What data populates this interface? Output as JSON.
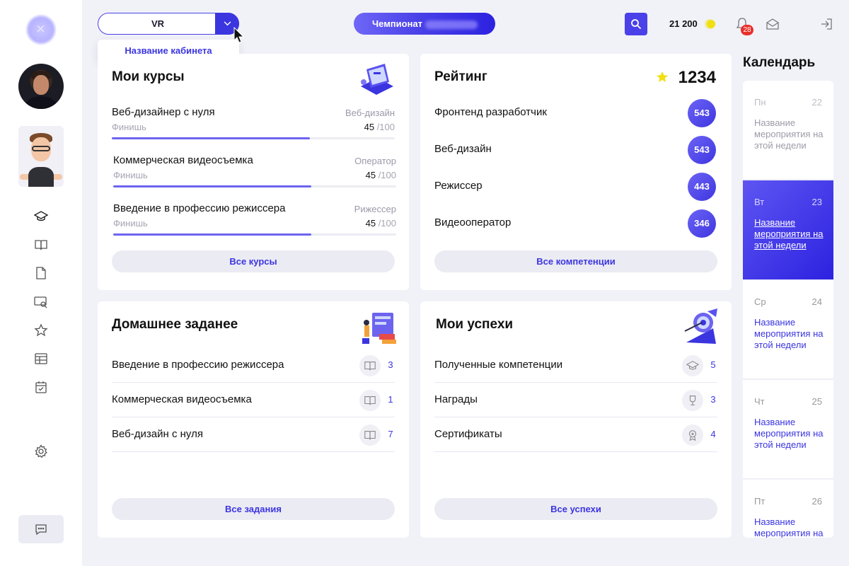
{
  "header": {
    "cabinet_value": "VR",
    "cabinet_option": "Название кабинета",
    "championship_label": "Чемпионат",
    "balance": "21 200",
    "notifications_count": "28"
  },
  "courses": {
    "title": "Мои курсы",
    "items": [
      {
        "name": "Веб-дизайнер с нуля",
        "category": "Веб-дизайн",
        "status": "Финишь",
        "score": "45",
        "max": "/100",
        "progress": 0.7
      },
      {
        "name": "Коммерческая видеосъемка",
        "category": "Оператор",
        "status": "Финишь",
        "score": "45",
        "max": "/100",
        "progress": 0.7
      },
      {
        "name": "Введение в профессию режиссера",
        "category": "Рижессер",
        "status": "Финишь",
        "score": "45",
        "max": "/100",
        "progress": 0.7
      }
    ],
    "button": "Все курсы"
  },
  "rating": {
    "title": "Рейтинг",
    "total": "1234",
    "items": [
      {
        "name": "Фронтенд разработчик",
        "value": "543"
      },
      {
        "name": "Веб-дизайн",
        "value": "543"
      },
      {
        "name": "Режиссер",
        "value": "443"
      },
      {
        "name": "Видеооператор",
        "value": "346"
      }
    ],
    "button": "Все компетенции"
  },
  "homework": {
    "title": "Домашнее заданее",
    "items": [
      {
        "name": "Введение в профессию режиссера",
        "count": "3",
        "icon": "book-icon"
      },
      {
        "name": "Коммерческая видеосъемка",
        "count": "1",
        "icon": "book-icon"
      },
      {
        "name": "Веб-дизайн с нуля",
        "count": "7",
        "icon": "book-icon"
      }
    ],
    "button": "Все задания"
  },
  "success": {
    "title": "Мои успехи",
    "items": [
      {
        "name": "Полученные компетенции",
        "count": "5",
        "icon": "graduation-cap-icon"
      },
      {
        "name": "Награды",
        "count": "3",
        "icon": "trophy-icon"
      },
      {
        "name": "Сертификаты",
        "count": "4",
        "icon": "certificate-icon"
      }
    ],
    "button": "Все успехи"
  },
  "calendar": {
    "title": "Календарь",
    "days": [
      {
        "day": "Пн",
        "date": "22",
        "event": "Название мероприятия на этой недели",
        "state": "past"
      },
      {
        "day": "Вт",
        "date": "23",
        "event": "Название мероприятия на этой недели",
        "state": "active"
      },
      {
        "day": "Ср",
        "date": "24",
        "event": "Название мероприятия на этой недели",
        "state": "normal"
      },
      {
        "day": "Чт",
        "date": "25",
        "event": "Название мероприятия на этой недели",
        "state": "normal"
      },
      {
        "day": "Пт",
        "date": "26",
        "event": "Название мероприятия на этой недели",
        "state": "normal"
      }
    ]
  },
  "colors": {
    "accent": "#4a41e8",
    "badge": "#e8302a",
    "coin": "#f1df12",
    "star": "#f1df12"
  }
}
